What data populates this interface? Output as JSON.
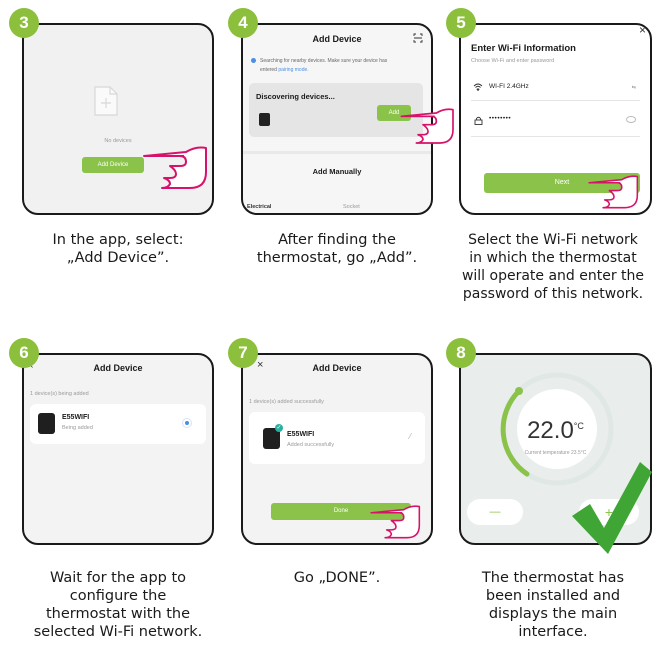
{
  "steps": [
    {
      "number": "3",
      "caption_l1": "In the app, select:",
      "caption_l2": "„Add Device”.",
      "empty_text": "No devices",
      "button": "Add Device"
    },
    {
      "number": "4",
      "caption_l1": "After finding the",
      "caption_l2": "thermostat, go „Add”.",
      "title": "Add Device",
      "search_text": "Searching for nearby devices. Make sure your device has",
      "search_text2": "entered",
      "pairing_link": "pairing mode.",
      "discovering": "Discovering devices...",
      "add_button": "Add",
      "add_manually": "Add Manually",
      "tab_left": "Electrical",
      "tab_right": "Socket"
    },
    {
      "number": "5",
      "caption_l1": "Select the Wi-Fi network",
      "caption_l2": "in which the thermostat",
      "caption_l3": "will operate and enter the",
      "caption_l4": "password of this network.",
      "title": "Enter Wi-Fi Information",
      "subtitle": "Choose Wi-Fi and enter password",
      "wifi_name": "WI-FI 2.4GHz",
      "password_mask": "••••••••",
      "next_button": "Next",
      "close": "×"
    },
    {
      "number": "6",
      "caption_l1": "Wait for the app to",
      "caption_l2": "configure the",
      "caption_l3": "thermostat with the",
      "caption_l4": "selected Wi-Fi network.",
      "title": "Add Device",
      "status": "1 device(s) being added",
      "device_name": "E55WIFI",
      "device_state": "Being added"
    },
    {
      "number": "7",
      "caption_l1": "Go „DONE”.",
      "title": "Add Device",
      "status": "1 device(s) added successfully",
      "device_name": "E55WIFI",
      "device_state": "Added successfully",
      "done_button": "Done",
      "close": "×"
    },
    {
      "number": "8",
      "caption_l1": "The thermostat has",
      "caption_l2": "been installed and",
      "caption_l3": "displays the main",
      "caption_l4": "interface.",
      "temperature": "22.0",
      "unit": "°C",
      "temp_label": "Current temperature 23.5°C",
      "minus": "—",
      "plus": "+"
    }
  ],
  "colors": {
    "accent": "#8bbf3c",
    "check": "#3fa535",
    "hand": "#d6126a"
  }
}
